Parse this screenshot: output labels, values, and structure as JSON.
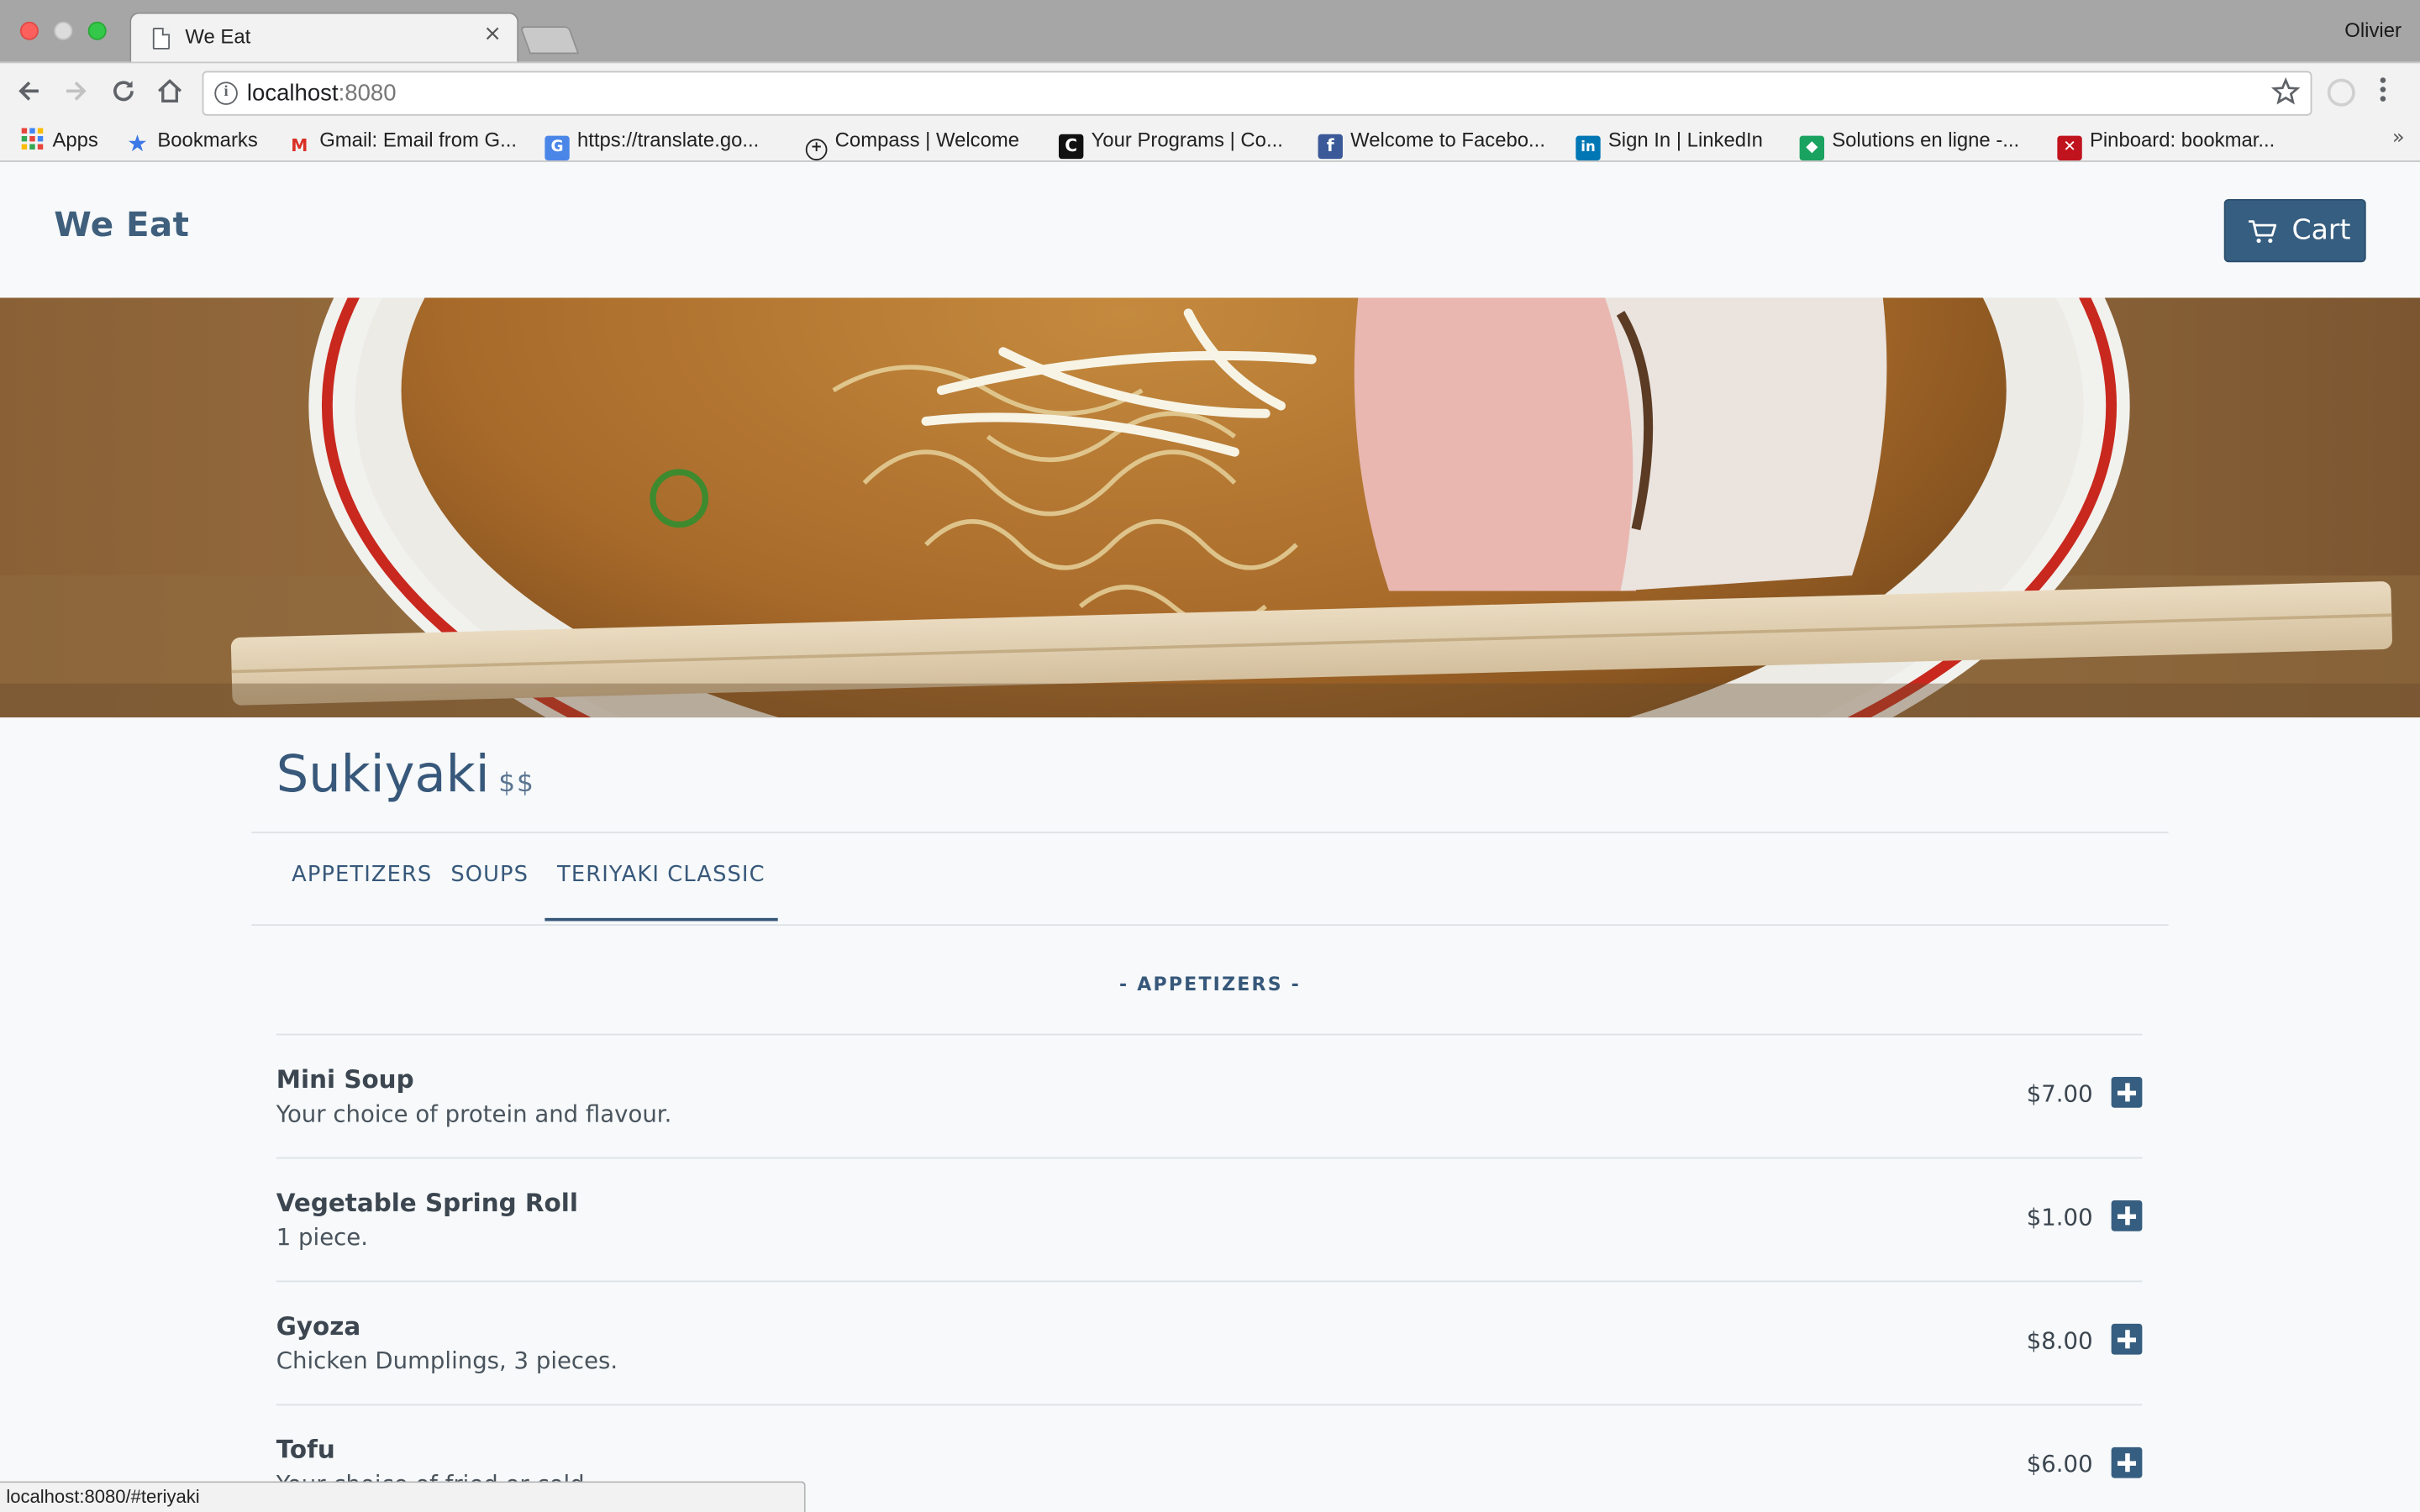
{
  "browser": {
    "tab_title": "We Eat",
    "tab_close": "×",
    "profile_name": "Olivier",
    "url_host": "localhost",
    "url_port": ":8080",
    "bookmarks": [
      {
        "label": "Apps",
        "icon": "apps-grid-icon"
      },
      {
        "label": "Bookmarks",
        "icon": "star-icon"
      },
      {
        "label": "Gmail: Email from G...",
        "icon": "gmail-icon"
      },
      {
        "label": "https://translate.go...",
        "icon": "google-translate-icon"
      },
      {
        "label": "Compass | Welcome",
        "icon": "compass-icon"
      },
      {
        "label": "Your Programs | Co...",
        "icon": "codecademy-icon"
      },
      {
        "label": "Welcome to Facebo...",
        "icon": "facebook-icon"
      },
      {
        "label": "Sign In | LinkedIn",
        "icon": "linkedin-icon"
      },
      {
        "label": "Solutions en ligne -...",
        "icon": "solutions-icon"
      },
      {
        "label": "Pinboard: bookmar...",
        "icon": "pinboard-icon"
      }
    ],
    "bookmarks_more": "»",
    "status_url": "localhost:8080/#teriyaki"
  },
  "navbar": {
    "brand": "We Eat",
    "cart_label": "Cart"
  },
  "restaurant": {
    "name": "Sukiyaki",
    "price_level": "$$"
  },
  "tabs": [
    {
      "label": "APPETIZERS",
      "active": false
    },
    {
      "label": "SOUPS",
      "active": false
    },
    {
      "label": "TERIYAKI CLASSIC",
      "active": true
    }
  ],
  "section": {
    "title": "- APPETIZERS -"
  },
  "items": [
    {
      "name": "Mini Soup",
      "description": "Your choice of protein and flavour.",
      "price": "$7.00"
    },
    {
      "name": "Vegetable Spring Roll",
      "description": "1 piece.",
      "price": "$1.00"
    },
    {
      "name": "Gyoza",
      "description": "Chicken Dumplings, 3 pieces.",
      "price": "$8.00"
    },
    {
      "name": "Tofu",
      "description": "Your choice of fried or cold.",
      "price": "$6.00"
    }
  ],
  "colors": {
    "accent": "#365e80",
    "text_primary": "#37587a",
    "background": "#f7f9fa"
  }
}
